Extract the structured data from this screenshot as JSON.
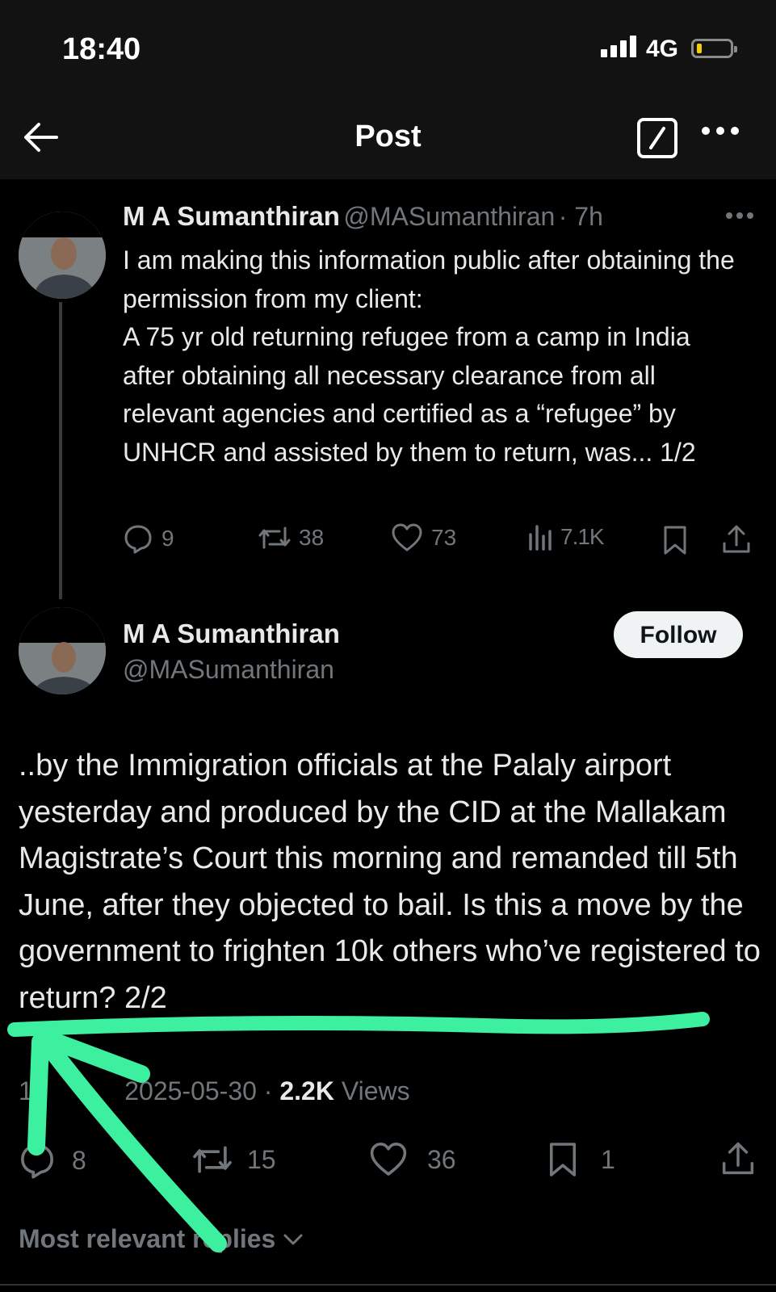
{
  "status_bar": {
    "time": "18:40",
    "network": "4G",
    "colors": {
      "battery_level": "#f5d000"
    }
  },
  "header": {
    "title": "Post"
  },
  "parent_tweet": {
    "author_name": "M A Sumanthiran",
    "author_handle": "@MASumanthiran",
    "time_ago": "· 7h",
    "text": "I am making this information public after obtaining the permission from my client:\nA 75 yr old returning refugee from a camp in India after obtaining all necessary clearance from all relevant agencies and certified as a “refugee” by UNHCR and assisted by them to return, was... 1/2",
    "replies": "9",
    "reposts": "38",
    "likes": "73",
    "views": "7.1K"
  },
  "main_tweet": {
    "author_name": "M A Sumanthiran",
    "author_handle": "@MASumanthiran",
    "follow_label": "Follow",
    "text": "..by the Immigration officials at the Palaly airport yesterday and produced by the CID at the Mallakam Magistrate’s Court this morning and remanded till 5th June, after they objected to bail. Is this a move by the government to frighten 10k others who’ve registered to return? 2/2",
    "time_visible": "11",
    "date": "2025-05-30",
    "separator": "·",
    "views_count": "2.2K",
    "views_label": "Views",
    "replies": "8",
    "reposts": "15",
    "likes": "36",
    "bookmarks": "1"
  },
  "replies_filter": {
    "label": "Most relevant replies"
  },
  "colors": {
    "annotation": "#3cf0a0",
    "muted": "#71767b",
    "text": "#e7e9ea"
  }
}
